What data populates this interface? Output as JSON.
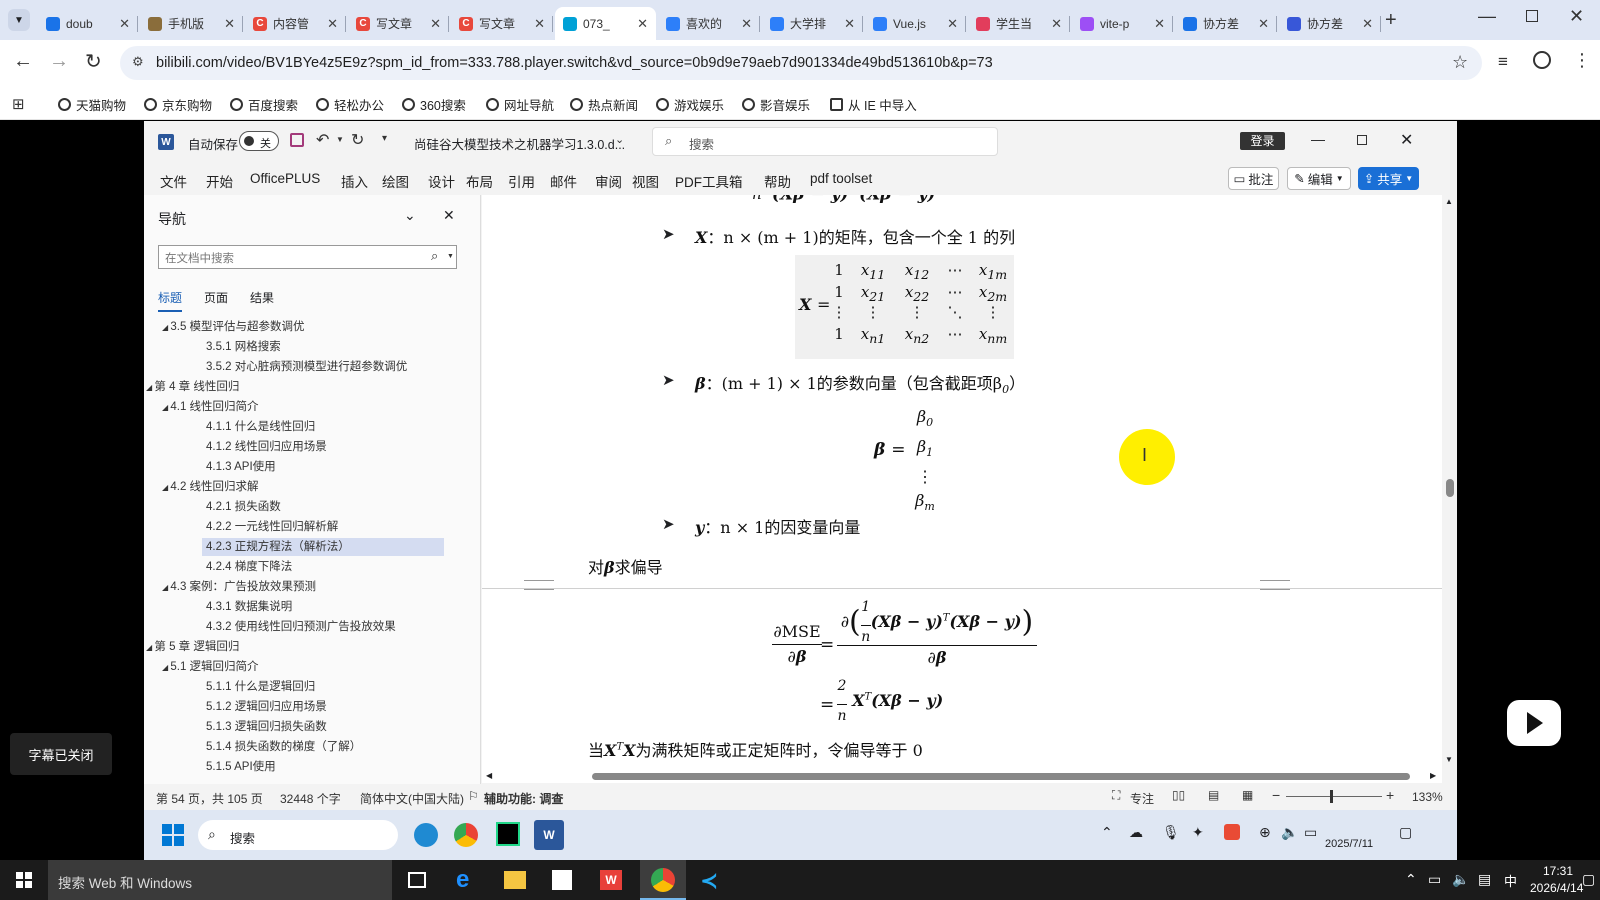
{
  "browser": {
    "tabs": [
      {
        "label": "doub",
        "fav": "search",
        "color": "#1a73e8"
      },
      {
        "label": "手机版",
        "fav": "avatar",
        "color": "#8a6d3b"
      },
      {
        "label": "内容管",
        "fav": "C",
        "color": "#e8483c"
      },
      {
        "label": "写文章",
        "fav": "C",
        "color": "#e8483c"
      },
      {
        "label": "写文章",
        "fav": "C",
        "color": "#e8483c"
      },
      {
        "label": "073_",
        "fav": "tv",
        "color": "#00a1d6"
      },
      {
        "label": "喜欢的",
        "fav": "bird",
        "color": "#2d7ff9"
      },
      {
        "label": "大学排",
        "fav": "bird",
        "color": "#2d7ff9"
      },
      {
        "label": "Vue.js",
        "fav": "bird",
        "color": "#2d7ff9"
      },
      {
        "label": "学生当",
        "fav": "shield",
        "color": "#e23d5c"
      },
      {
        "label": "vite-p",
        "fav": "bolt",
        "color": "#9d4ff5"
      },
      {
        "label": "协方差",
        "fav": "search",
        "color": "#1a73e8"
      },
      {
        "label": "协方差",
        "fav": "paw",
        "color": "#3857d8"
      }
    ],
    "url": "bilibili.com/video/BV1BYe4z5E9z?spm_id_from=333.788.player.switch&vd_source=0b9d9e79aeb7d901334de49bd513610b&p=73",
    "bookmarks": [
      "天猫购物",
      "京东购物",
      "百度搜索",
      "轻松办公",
      "360搜索",
      "网址导航",
      "热点新闻",
      "游戏娱乐",
      "影音娱乐",
      "从 IE 中导入"
    ]
  },
  "word": {
    "autosave_label": "自动保存",
    "autosave_state": "关",
    "doc_title": "尚硅谷大模型技术之机器学习1.3.0.d...",
    "search_placeholder": "搜索",
    "login_label": "登录",
    "menus": [
      "文件",
      "开始",
      "OfficePLUS",
      "插入",
      "绘图",
      "设计",
      "布局",
      "引用",
      "邮件",
      "审阅",
      "视图",
      "PDF工具箱",
      "帮助",
      "pdf toolset"
    ],
    "comment_btn": "批注",
    "edit_btn": "编辑",
    "share_btn": "共享",
    "nav": {
      "title": "导航",
      "search_placeholder": "在文档中搜索",
      "tabs": [
        "标题",
        "页面",
        "结果"
      ],
      "items": [
        {
          "t": "3.5 模型评估与超参数调优",
          "lvl": 2
        },
        {
          "t": "3.5.1 网格搜索",
          "lvl": 3
        },
        {
          "t": "3.5.2 对心脏病预测模型进行超参数调优",
          "lvl": 3
        },
        {
          "t": "第 4 章 线性回归",
          "lvl": 1
        },
        {
          "t": "4.1 线性回归简介",
          "lvl": 2
        },
        {
          "t": "4.1.1 什么是线性回归",
          "lvl": 3
        },
        {
          "t": "4.1.2 线性回归应用场景",
          "lvl": 3
        },
        {
          "t": "4.1.3 API使用",
          "lvl": 3
        },
        {
          "t": "4.2 线性回归求解",
          "lvl": 2
        },
        {
          "t": "4.2.1 损失函数",
          "lvl": 3
        },
        {
          "t": "4.2.2 一元线性回归解析解",
          "lvl": 3
        },
        {
          "t": "4.2.3 正规方程法（解析法）",
          "lvl": 3,
          "sel": true
        },
        {
          "t": "4.2.4 梯度下降法",
          "lvl": 3
        },
        {
          "t": "4.3 案例：广告投放效果预测",
          "lvl": 2
        },
        {
          "t": "4.3.1 数据集说明",
          "lvl": 3
        },
        {
          "t": "4.3.2 使用线性回归预测广告投放效果",
          "lvl": 3
        },
        {
          "t": "第 5 章 逻辑回归",
          "lvl": 1
        },
        {
          "t": "5.1 逻辑回归简介",
          "lvl": 2
        },
        {
          "t": "5.1.1 什么是逻辑回归",
          "lvl": 3
        },
        {
          "t": "5.1.2 逻辑回归应用场景",
          "lvl": 3
        },
        {
          "t": "5.1.3 逻辑回归损失函数",
          "lvl": 3
        },
        {
          "t": "5.1.4 损失函数的梯度（了解）",
          "lvl": 3
        },
        {
          "t": "5.1.5 API使用",
          "lvl": 3
        }
      ]
    },
    "doc": {
      "x_desc": "：n × (m + 1)的矩阵，包含一个全 1 的列",
      "beta_desc": "：(m + 1) × 1的参数向量（包含截距项β",
      "y_desc": "：n × 1的因变量向量",
      "partial_label": "求偏导",
      "partial_prefix": "对",
      "condition": "为满秩矩阵或正定矩阵时，令偏导等于 0",
      "condition_prefix": "当"
    },
    "status": {
      "page": "第 54 页，共 105 页",
      "words": "32448 个字",
      "lang": "简体中文(中国大陆)",
      "accessibility": "辅助功能: 调查",
      "focus": "专注",
      "zoom": "133%"
    },
    "taskbar": {
      "search": "搜索",
      "date": "2025/7/11"
    }
  },
  "subtitle_toast": "字幕已关闭",
  "windows_taskbar": {
    "search": "搜索 Web 和 Windows",
    "time": "17:31",
    "date": "2026/4/14",
    "ime": "中"
  }
}
